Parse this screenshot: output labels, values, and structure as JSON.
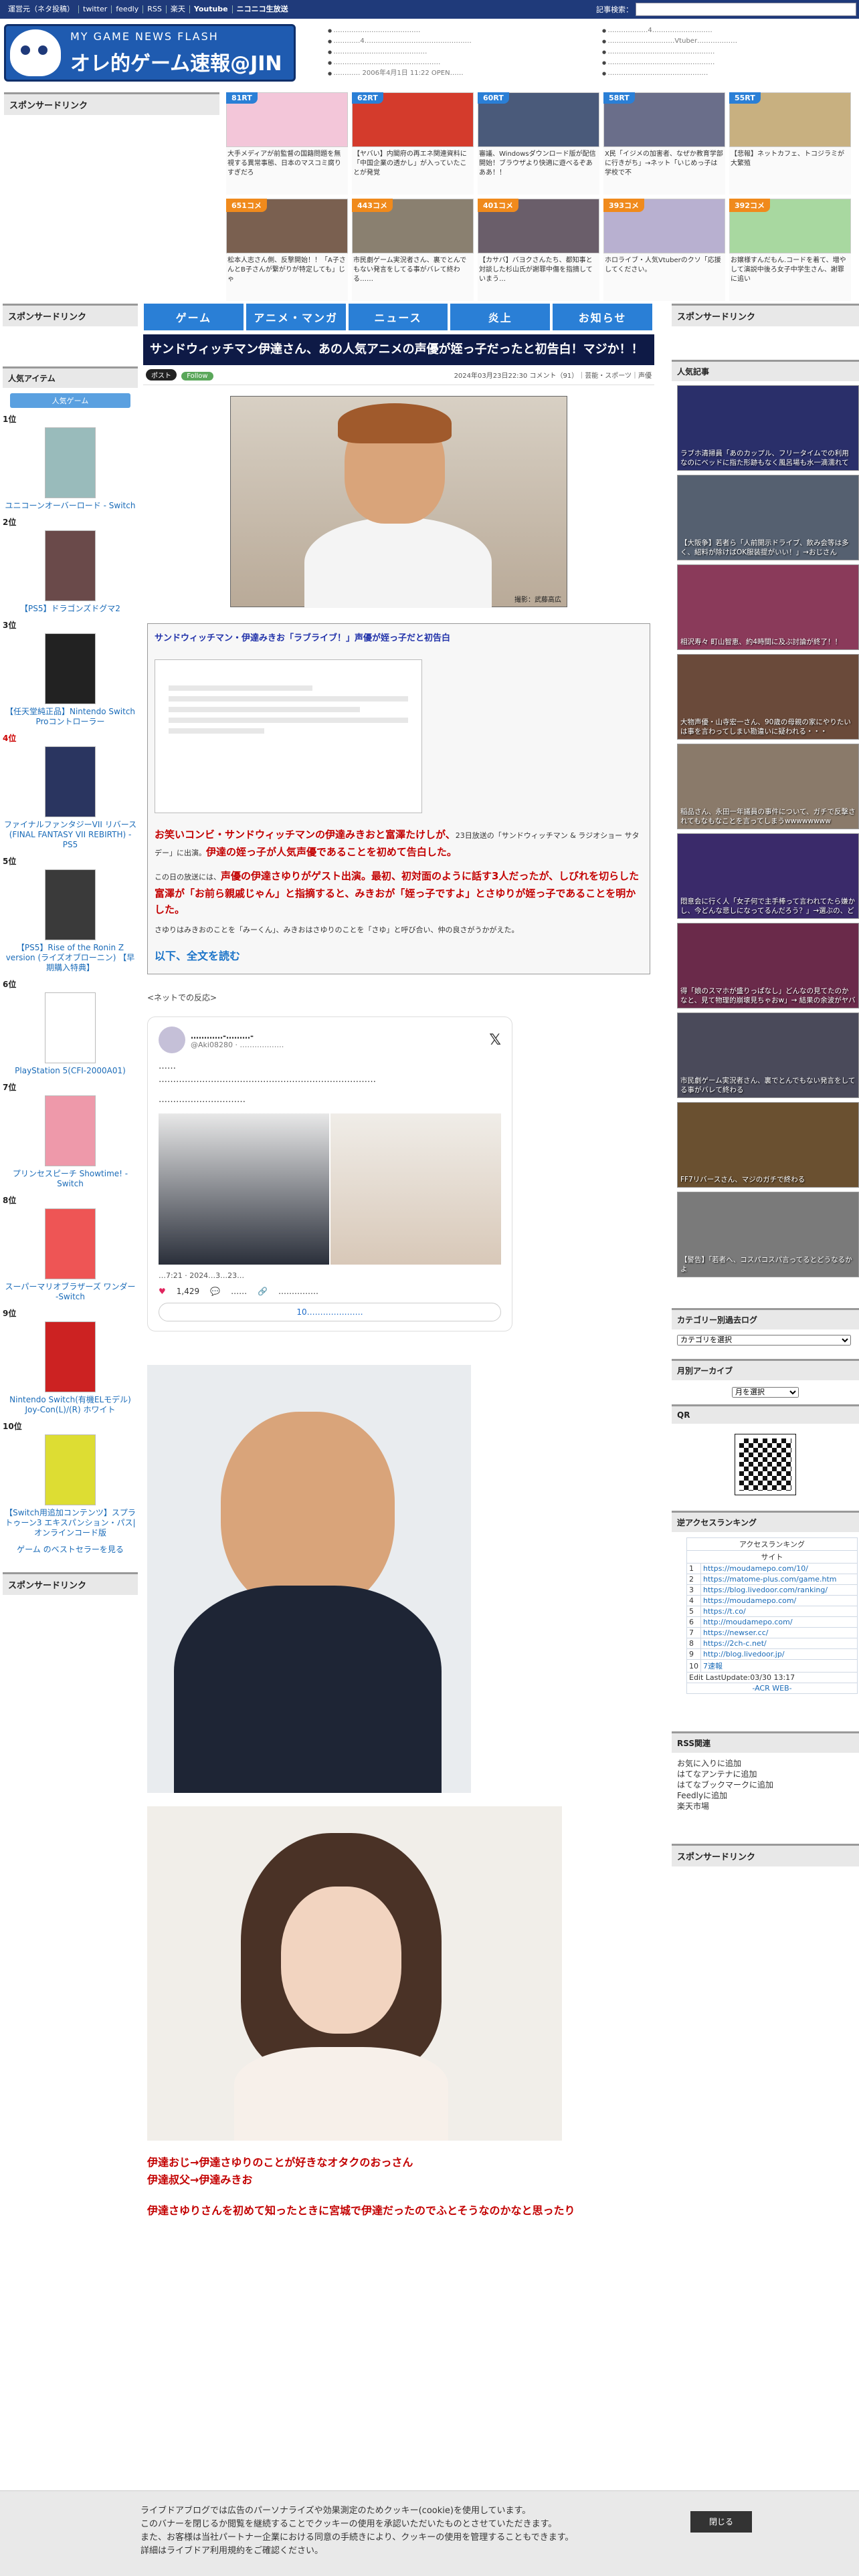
{
  "topbar": {
    "links": [
      "運営元（ネタ投稿）",
      "twitter",
      "feedly",
      "RSS",
      "楽天",
      "Youtube",
      "ニコニコ生放送"
    ],
    "search_label": "記事検索："
  },
  "logo": {
    "line1": "MY GAME NEWS FLASH",
    "line2": "オレ的ゲーム速報@JIN"
  },
  "header_news_left": [
    "…………………………………",
    "…………4…………………………………………",
    "……………………………………",
    "…………………………………………",
    "………… 2006年4月1日 11:22 OPEN……"
  ],
  "header_news_right": [
    "………………4………………………",
    "…………………………Vtuber………………",
    "…………………………………………",
    "…………………………………………",
    "………………………………………"
  ],
  "sponsored": "スポンサードリンク",
  "ranking": [
    {
      "tag": "81RT",
      "color": "#2a7fd6",
      "text": "大手メディアが前監督の国籍問題を無視する異常事態、日本のマスコミ腐りすぎだろ"
    },
    {
      "tag": "62RT",
      "color": "#2a7fd6",
      "text": "【ヤバい】内閣府の再エネ関連資料に「中国企業の透かし」が入っていたことが発覚"
    },
    {
      "tag": "60RT",
      "color": "#2a7fd6",
      "text": "審議、Windowsダウンロード版が配信開始！ブラウザより快適に遊べるぞあああ！！"
    },
    {
      "tag": "58RT",
      "color": "#2a7fd6",
      "text": "X民「イジメの加害者、なぜか教育学部に行きがち」→ネット「いじめっ子は学校で不"
    },
    {
      "tag": "55RT",
      "color": "#2a7fd6",
      "text": "【悲報】ネットカフェ、トコジラミが大繁殖"
    },
    {
      "tag": "651コメ",
      "color": "#f08a1c",
      "text": "松本人志さん側、反撃開始！！「A子さんとB子さんが繋がりが特定しても」じゃ"
    },
    {
      "tag": "443コメ",
      "color": "#f08a1c",
      "text": "市民劇ゲーム実況者さん、裏でとんでもない発言をしてる事がバレて終わる……"
    },
    {
      "tag": "401コメ",
      "color": "#f08a1c",
      "text": "【カサバ】バヨクさんたち、都知事と対談した杉山氏が謝罪中傷を指摘していまう…"
    },
    {
      "tag": "393コメ",
      "color": "#f08a1c",
      "text": "ホロライブ・人気Vtuberのクソ「応援してください。"
    },
    {
      "tag": "392コメ",
      "color": "#f08a1c",
      "text": "お嬢様すんだもん.コードを着て、増やして演説中後ろ女子中学生さん、謝罪に追い"
    }
  ],
  "nav": [
    "ゲーム",
    "アニメ・マンガ",
    "ニュース",
    "炎上",
    "お知らせ"
  ],
  "left": {
    "sponsored": "スポンサードリンク",
    "popular_title": "人気アイテム",
    "tab": "人気ゲーム",
    "items": [
      {
        "pos": "1位",
        "name": "ユニコーンオーバーロード - Switch",
        "color": "#9bb"
      },
      {
        "pos": "2位",
        "name": "【PS5】ドラゴンズドグマ2",
        "color": "#6a4a4a"
      },
      {
        "pos": "3位",
        "name": "【任天堂純正品】Nintendo Switch Proコントローラー",
        "color": "#222"
      },
      {
        "pos": "4位",
        "name": "ファイナルファンタジーVII リバース(FINAL FANTASY VII REBIRTH) -PS5",
        "color": "#2a3560"
      },
      {
        "pos": "5位",
        "name": "【PS5】Rise of the Ronin Z version (ライズオブローニン) 【早期購入特典】",
        "color": "#3a3a3a"
      },
      {
        "pos": "6位",
        "name": "PlayStation 5(CFI-2000A01)",
        "color": "#fff"
      },
      {
        "pos": "7位",
        "name": "プリンセスピーチ Showtime! -Switch",
        "color": "#e9a"
      },
      {
        "pos": "8位",
        "name": "スーパーマリオブラザーズ ワンダー -Switch",
        "color": "#e55"
      },
      {
        "pos": "9位",
        "name": "Nintendo Switch(有機ELモデル) Joy-Con(L)/(R) ホワイト",
        "color": "#c22"
      },
      {
        "pos": "10位",
        "name": "【Switch用追加コンテンツ】スプラトゥーン3 エキスパンション・パス|オンラインコード版",
        "color": "#dd3"
      }
    ],
    "bestseller": "ゲーム のベストセラーを見る",
    "sponsored2": "スポンサードリンク"
  },
  "article": {
    "title": "サンドウィッチマン伊達さん、あの人気アニメの声優が姪っ子だったと初告白！マジか！！",
    "buttons": [
      "ポスト",
      "Follow"
    ],
    "date": "2024年03月23日22:30",
    "meta": "コメント（91）｜芸能・スポーツ｜声優",
    "hero_caption": "撮影：武藤高広",
    "quote_title": "サンドウィッチマン・伊達みきお「ラブライブ！」声優が姪っ子だと初告白",
    "lead_plain": "お笑いコンビ・サンドウィッチマンの伊達みきおと富澤たけしが、",
    "lead_small": "23日放送の「サンドウィッチマン & ラジオショー サタデー」に出演。",
    "lead_red2": "伊達の姪っ子が人気声優であることを初めて告白した。",
    "p2_plain": "この日の放送には、",
    "p2_red": "声優の伊達さゆりがゲスト出演。最初、初対面のように話す3人だったが、しびれを切らした富澤が「お前ら親戚じゃん」と指摘すると、みきおが「姪っ子ですよ」とさゆりが姪っ子であることを明かした。",
    "p3": "さゆりはみきおのことを「みーくん」、みきおはさゆりのことを「さゆ」と呼び合い、仲の良さがうかがえた。",
    "more": "以下、全文を読む",
    "net_reaction": "<ネットでの反応>",
    "tweet": {
      "name": "…………-………-",
      "handle": "@Aki08280 · ………………",
      "text1": "……",
      "text2": "…………………………………………………………………",
      "text3": "…………………………",
      "time": "…7:21 · 2024…3…23…",
      "likes": "1,429",
      "reply": "……",
      "copy": "……………",
      "read": "10…………………"
    },
    "tail1": "伊達おじ→伊達さゆりのことが好きなオタクのおっさん",
    "tail2": "伊達叔父→伊達みきお",
    "tail3": "伊達さゆりさんを初めて知ったときに宮城で伊達だったのでふとそうなのかなと思ったり"
  },
  "right": {
    "sponsored": "スポンサードリンク",
    "popular": "人気記事",
    "articles": [
      {
        "cap": "ラブホ清掃員「あのカップル、フリータイムでの利用なのにベッドに指た形跡もなく風呂場も水一滴濡れて",
        "color": "#2a2f6a"
      },
      {
        "cap": "【大阪争】若者ら「人前開示ドライブ、飲み会等は多く、紹料が除けばOK服装提がいい！」→おじさん",
        "color": "#556070"
      },
      {
        "cap": "相沢寿々 町山智恵、約4時間に及ぶ討論が終了！！",
        "color": "#8a3a5a"
      },
      {
        "cap": "大物声優・山寺宏一さん、90歳の母親の家にやりたいは事を言わってしまい勘違いに疑われる・・・",
        "color": "#6a4a3a"
      },
      {
        "cap": "稲品さん、永田一年議員の事件について、ガチで反撃されてもなもなことを言ってしまうwwwwwwww",
        "color": "#8a7a6a"
      },
      {
        "cap": "悶意会に行く人「女子何で主手棒って言われてたら嫌かし、今どんな悲しになってるんだろう？」→選ぶの、ど",
        "color": "#3a2a6a"
      },
      {
        "cap": "得「娘のスマホが盛りっぱなし」どんなの見てたのかなと、見て物理的崩壊見ちゃおw」→ 結果の余波がヤバ",
        "color": "#6a2a4a"
      },
      {
        "cap": "市民劇ゲーム実況者さん、裏でとんでもない発言をしてる事がバレて終わる",
        "color": "#4a4a5a"
      },
      {
        "cap": "FF7リバースさん、マジのガチで終わる",
        "color": "#6a5030"
      },
      {
        "cap": "【警告】「若者へ、コスパコスパ言ってるとどうなるかよ",
        "color": "#7a7a7a"
      }
    ],
    "cat_title": "カテゴリー別過去ログ",
    "cat_select": "カテゴリを選択",
    "month_title": "月別アーカイブ",
    "month_select": "月を選択",
    "qr_title": "QR",
    "access_title": "逆アクセスランキング",
    "access_head1": "アクセスランキング",
    "access_head2": "サイト",
    "access_sites": [
      "https://moudamepo.com/10/",
      "https://matome-plus.com/game.htm",
      "https://blog.livedoor.com/ranking/",
      "https://moudamepo.com/",
      "https://t.co/",
      "http://moudamepo.com/",
      "https://newser.cc/",
      "https://2ch-c.net/",
      "http://blog.livedoor.jp/",
      "7速報"
    ],
    "access_footer": "Edit LastUpdate:03/30 13:17",
    "access_powered": "-ACR WEB-",
    "rss_title": "RSS関連",
    "rss_links": [
      "お気に入りに追加",
      "はてなアンテナに追加",
      "はてなブックマークに追加",
      "Feedlyに追加",
      "楽天市場"
    ],
    "sponsored2": "スポンサードリンク"
  },
  "cookie": {
    "l1": "ライブドアブログでは広告のパーソナライズや効果測定のためクッキー(cookie)を使用しています。",
    "l2": "このバナーを閉じるか閲覧を継続することでクッキーの使用を承認いただいたものとさせていただきます。",
    "l3": "また、お客様は当社パートナー企業における同意の手続きにより、クッキーの使用を管理することもできます。",
    "l4": "詳細はライブドア利用規約をご確認ください。",
    "close": "閉じる"
  }
}
